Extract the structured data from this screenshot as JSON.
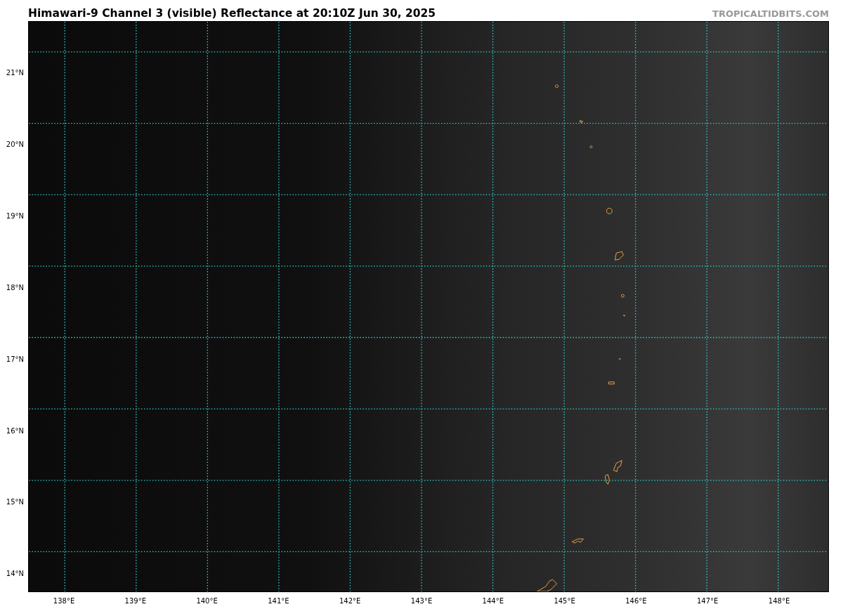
{
  "title": "Himawari-9 Channel 3 (visible) Reflectance at 20:10Z Jun 30, 2025",
  "credit": "TROPICALTIDBITS.COM",
  "map": {
    "latitude_labels": [
      "21°N",
      "20°N",
      "19°N",
      "18°N",
      "17°N",
      "16°N",
      "15°N",
      "14°N"
    ],
    "longitude_labels": [
      "138°E",
      "139°E",
      "140°E",
      "141°E",
      "142°E",
      "143°E",
      "144°E",
      "145°E",
      "146°E",
      "147°E",
      "148°E"
    ]
  }
}
